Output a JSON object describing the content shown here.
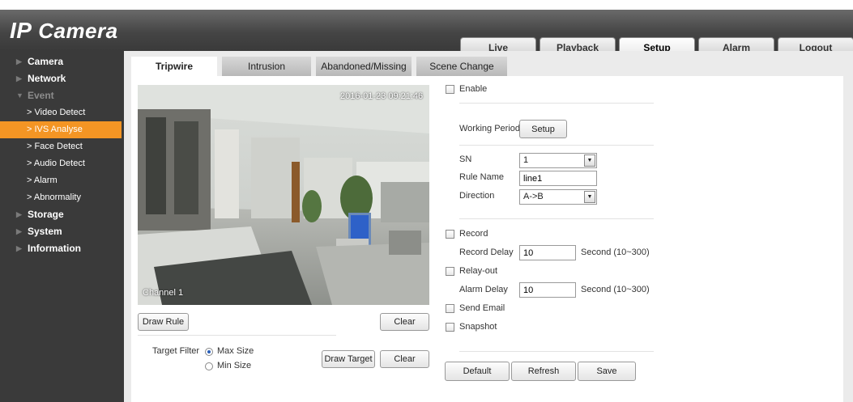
{
  "header": {
    "logo_prefix": "IP",
    "logo_text": "Camera"
  },
  "nav": [
    {
      "label": "Live",
      "active": false
    },
    {
      "label": "Playback",
      "active": false
    },
    {
      "label": "Setup",
      "active": true
    },
    {
      "label": "Alarm",
      "active": false
    },
    {
      "label": "Logout",
      "active": false
    }
  ],
  "sidebar": {
    "camera": "Camera",
    "network": "Network",
    "event": "Event",
    "event_items": [
      "Video Detect",
      "IVS Analyse",
      "Face Detect",
      "Audio Detect",
      "Alarm",
      "Abnormality"
    ],
    "event_active": "IVS Analyse",
    "storage": "Storage",
    "system": "System",
    "information": "Information"
  },
  "tabs": [
    "Tripwire",
    "Intrusion",
    "Abandoned/Missing",
    "Scene Change"
  ],
  "video": {
    "timestamp": "2016-01-23 09:21:46",
    "channel": "Channel 1"
  },
  "buttons": {
    "draw_rule": "Draw Rule",
    "clear": "Clear",
    "draw_target": "Draw Target",
    "clear_target": "Clear",
    "setup": "Setup",
    "default": "Default",
    "refresh": "Refresh",
    "save": "Save"
  },
  "target_filter": {
    "label": "Target Filter",
    "options": [
      "Max Size",
      "Min Size"
    ],
    "selected": "Max Size"
  },
  "form": {
    "enable": "Enable",
    "working_period": "Working Period",
    "sn_label": "SN",
    "sn_value": "1",
    "rule_name_label": "Rule Name",
    "rule_name_value": "line1",
    "direction_label": "Direction",
    "direction_value": "A->B",
    "record": "Record",
    "record_delay_label": "Record Delay",
    "record_delay_value": "10",
    "record_delay_unit": "Second (10~300)",
    "relay_out": "Relay-out",
    "alarm_delay_label": "Alarm Delay",
    "alarm_delay_value": "10",
    "alarm_delay_unit": "Second (10~300)",
    "send_email": "Send Email",
    "snapshot": "Snapshot"
  }
}
